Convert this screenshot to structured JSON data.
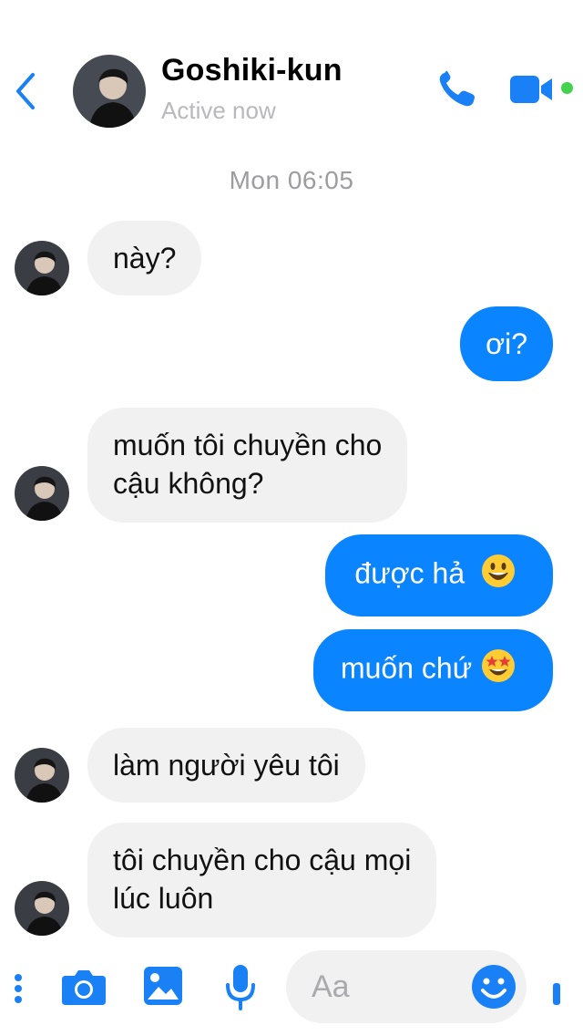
{
  "header": {
    "back_icon": "chevron-left-icon",
    "contact_name": "Goshiki-kun",
    "status": "Active now",
    "call_icon": "phone-icon",
    "video_icon": "video-camera-icon",
    "online": true
  },
  "conversation": {
    "timestamp": "Mon 06:05",
    "messages": [
      {
        "from": "contact",
        "text": "này?"
      },
      {
        "from": "me",
        "text": "ơi?"
      },
      {
        "from": "contact",
        "lines": [
          "muốn tôi chuyền cho",
          "cậu không?"
        ]
      },
      {
        "from": "me",
        "text": "được hả",
        "emoji": "😃"
      },
      {
        "from": "me",
        "text": "muốn chứ",
        "emoji": "🤩"
      },
      {
        "from": "contact",
        "text": "làm người yêu tôi"
      },
      {
        "from": "contact",
        "lines": [
          "tôi chuyền cho cậu mọi",
          "lúc luôn"
        ]
      }
    ]
  },
  "composer": {
    "placeholder": "Aa",
    "tools": [
      "more-icon",
      "camera-icon",
      "image-icon",
      "microphone-icon"
    ],
    "emoji_icon": "smiley-icon"
  },
  "colors": {
    "accent": "#0a84ff",
    "incoming_bubble": "#f1f1f2",
    "online": "#44d14e"
  }
}
